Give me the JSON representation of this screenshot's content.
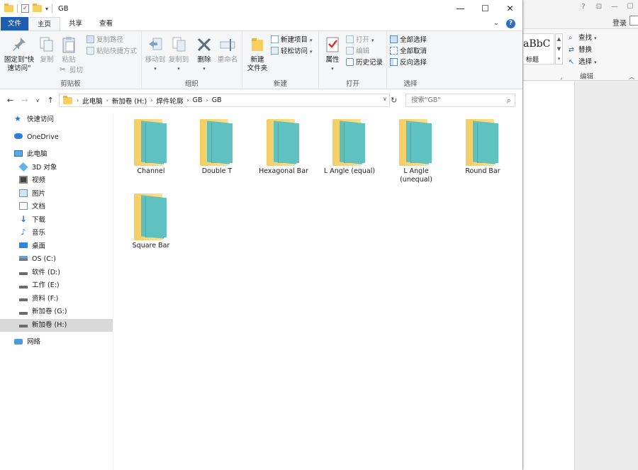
{
  "window": {
    "title": "GB",
    "controls": {
      "minimize": "—",
      "maximize": "☐",
      "close": "✕"
    }
  },
  "tabs": [
    {
      "label": "文件"
    },
    {
      "label": "主页"
    },
    {
      "label": "共享"
    },
    {
      "label": "查看"
    }
  ],
  "ribbon": {
    "clipboard": {
      "label": "剪贴板",
      "pin": "固定到\"快\n速访问\"",
      "copy": "复制",
      "paste": "粘贴",
      "copy_path": "复制路径",
      "paste_shortcut": "粘贴快捷方式",
      "cut": "剪切"
    },
    "organize": {
      "label": "组织",
      "move_to": "移动到",
      "copy_to": "复制到",
      "delete": "删除",
      "rename": "重命名"
    },
    "new": {
      "label": "新建",
      "new_folder": "新建\n文件夹",
      "new_item": "新建项目",
      "easy_access": "轻松访问"
    },
    "open": {
      "label": "打开",
      "properties": "属性",
      "open": "打开",
      "edit": "编辑",
      "history": "历史记录"
    },
    "select": {
      "label": "选择",
      "select_all": "全部选择",
      "select_none": "全部取消",
      "invert": "反向选择"
    }
  },
  "address": {
    "crumbs": [
      "此电脑",
      "新加卷 (H:)",
      "焊件轮廓",
      "GB",
      "GB"
    ],
    "search_placeholder": "搜索\"GB\""
  },
  "nav": {
    "items": [
      {
        "label": "快速访问",
        "icon": "star-icon"
      },
      {
        "label": "OneDrive",
        "icon": "cloud-icon"
      },
      {
        "label": "此电脑",
        "icon": "computer-icon"
      },
      {
        "label": "3D 对象",
        "icon": "cube-icon"
      },
      {
        "label": "视频",
        "icon": "video-icon"
      },
      {
        "label": "图片",
        "icon": "picture-icon"
      },
      {
        "label": "文档",
        "icon": "document-icon"
      },
      {
        "label": "下载",
        "icon": "download-icon"
      },
      {
        "label": "音乐",
        "icon": "music-icon"
      },
      {
        "label": "桌面",
        "icon": "desktop-icon"
      },
      {
        "label": "OS (C:)",
        "icon": "drive-os-icon"
      },
      {
        "label": "软件 (D:)",
        "icon": "drive-icon"
      },
      {
        "label": "工作 (E:)",
        "icon": "drive-icon"
      },
      {
        "label": "资料 (F:)",
        "icon": "drive-icon"
      },
      {
        "label": "新加卷 (G:)",
        "icon": "drive-icon"
      },
      {
        "label": "新加卷 (H:)",
        "icon": "drive-icon",
        "selected": true
      },
      {
        "label": "网络",
        "icon": "network-icon"
      }
    ]
  },
  "folders": [
    {
      "name": "Channel"
    },
    {
      "name": "Double T"
    },
    {
      "name": "Hexagonal Bar"
    },
    {
      "name": "L Angle (equal)"
    },
    {
      "name": "L Angle\n(unequal)"
    },
    {
      "name": "Round Bar"
    },
    {
      "name": "Square Bar"
    }
  ],
  "background_app": {
    "login": "登录",
    "style_preview": "aBbC",
    "style_name": "标题",
    "find": "查找",
    "replace": "替换",
    "select": "选择",
    "group_label": "编辑"
  },
  "colors": {
    "file_tab": "#1e5eb0",
    "folder_yellow": "#f8d774",
    "folder_teal": "#5fc2c0",
    "selection": "#d9d9d9"
  }
}
